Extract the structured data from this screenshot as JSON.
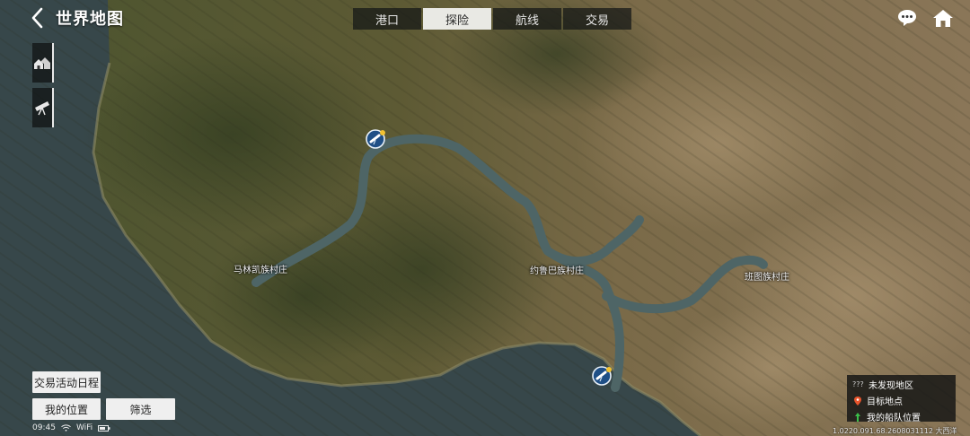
{
  "header": {
    "title": "世界地图",
    "tabs": [
      {
        "label": "港口",
        "active": false
      },
      {
        "label": "探险",
        "active": true
      },
      {
        "label": "航线",
        "active": false
      },
      {
        "label": "交易",
        "active": false
      }
    ]
  },
  "icons": {
    "back": "chevron-left-icon",
    "chat": "chat-bubble-icon",
    "home": "home-icon",
    "side_tools": [
      "village-icon",
      "telescope-icon"
    ],
    "explore_marker": "telescope-marker-icon"
  },
  "map": {
    "labels": [
      "马林凯族村庄",
      "约鲁巴族村庄",
      "班图族村庄"
    ]
  },
  "buttons": {
    "trade_schedule": "交易活动日程",
    "my_position": "我的位置",
    "filter": "筛选"
  },
  "status_bar": {
    "time": "09:45",
    "wifi": "WiFi"
  },
  "legend": {
    "undiscovered_mark": "???",
    "undiscovered": "未发现地区",
    "target": "目标地点",
    "fleet": "我的船队位置"
  },
  "coords": "1.0220.091.68.2608031112 大西洋",
  "colors": {
    "tab_active_bg": "#e9e9e4",
    "tab_bg": "#141616",
    "river": "#4e6566",
    "sea": "#3a4a49",
    "target_pin": "#e8542c",
    "fleet_pin": "#3bbf4a"
  }
}
